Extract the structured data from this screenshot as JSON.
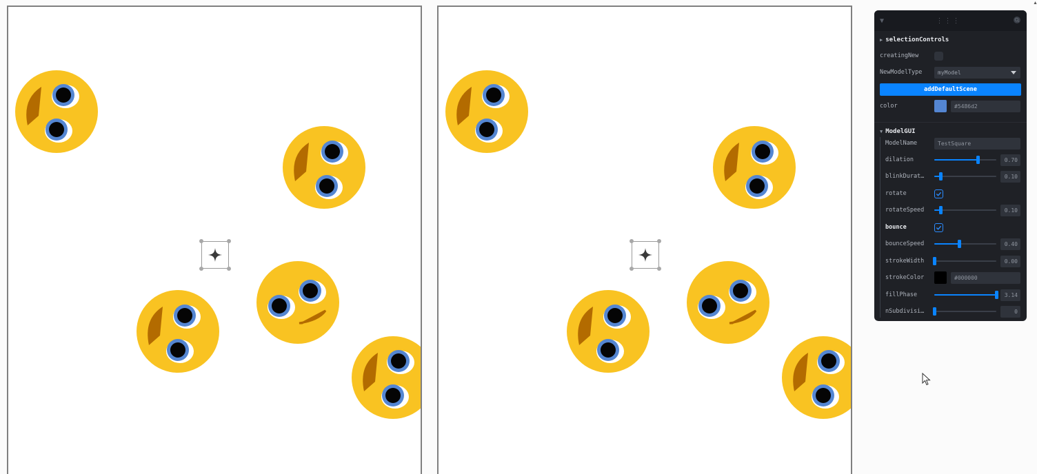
{
  "viewports": [
    {
      "name": "left"
    },
    {
      "name": "right"
    }
  ],
  "gui": {
    "selectionControls": {
      "title": "selectionControls",
      "creatingNew_label": "creatingNew",
      "creatingNew_checked": false,
      "newModelType_label": "NewModelType",
      "newModelType_value": "myModel",
      "addDefaultScene_label": "addDefaultScene",
      "color_label": "color",
      "color_value": "#5486d2",
      "color_hex": "#5486d2"
    },
    "modelGUI": {
      "title": "ModelGUI",
      "modelName_label": "ModelName",
      "modelName_value": "TestSquare",
      "dilation_label": "dilation",
      "dilation_value": "0.70",
      "dilation_fraction": 0.7,
      "blinkDuration_label": "blinkDurat…",
      "blinkDuration_value": "0.10",
      "blinkDuration_fraction": 0.1,
      "rotate_label": "rotate",
      "rotate_checked": true,
      "rotateSpeed_label": "rotateSpeed",
      "rotateSpeed_value": "0.10",
      "rotateSpeed_fraction": 0.1,
      "bounce_label": "bounce",
      "bounce_checked": true,
      "bounceSpeed_label": "bounceSpeed",
      "bounceSpeed_value": "0.40",
      "bounceSpeed_fraction": 0.4,
      "strokeWidth_label": "strokeWidth",
      "strokeWidth_value": "0.00",
      "strokeWidth_fraction": 0.0,
      "strokeColor_label": "strokeColor",
      "strokeColor_value": "#000000",
      "strokeColor_hex": "#000000",
      "fillPhase_label": "fillPhase",
      "fillPhase_value": "3.14",
      "fillPhase_fraction": 1.0,
      "nSubdivisions_label": "nSubdivisi…",
      "nSubdivisions_value": "0",
      "nSubdivisions_fraction": 0.0
    }
  },
  "colors": {
    "face": "#f9c322",
    "iris": "#5486d2",
    "mouth": "#b36b00",
    "accent": "#0a84ff"
  }
}
